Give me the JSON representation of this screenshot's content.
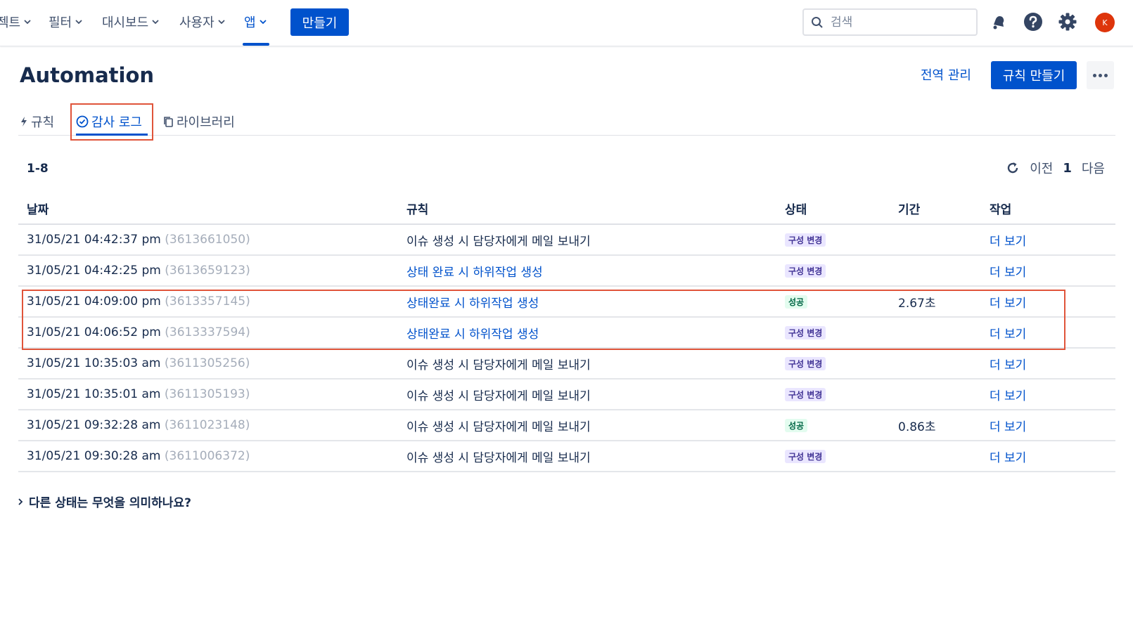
{
  "nav": {
    "items": [
      {
        "label": "젝트",
        "active": false
      },
      {
        "label": "필터",
        "active": false
      },
      {
        "label": "대시보드",
        "active": false
      },
      {
        "label": "사용자",
        "active": false
      },
      {
        "label": "앱",
        "active": true
      }
    ],
    "create_label": "만들기",
    "search_placeholder": "검색",
    "avatar_initial": "K"
  },
  "header": {
    "title": "Automation",
    "global_link": "전역 관리",
    "create_rule_label": "규칙 만들기"
  },
  "tabs": [
    {
      "label": "규칙",
      "icon": "lightning-icon",
      "active": false
    },
    {
      "label": "감사 로그",
      "icon": "check-circle-icon",
      "active": true
    },
    {
      "label": "라이브러리",
      "icon": "copy-icon",
      "active": false
    }
  ],
  "pagination": {
    "range": "1-8",
    "prev_label": "이전",
    "page": "1",
    "next_label": "다음"
  },
  "table": {
    "columns": [
      "날짜",
      "규칙",
      "상태",
      "기간",
      "작업"
    ],
    "rows": [
      {
        "date": "31/05/21 04:42:37 pm",
        "id": "(3613661050)",
        "rule": "이슈 생성 시 담당자에게 메일 보내기",
        "rule_link": false,
        "status": "구성 변경",
        "status_type": "config",
        "duration": "",
        "action": "더 보기"
      },
      {
        "date": "31/05/21 04:42:25 pm",
        "id": "(3613659123)",
        "rule": "상태 완료 시 하위작업 생성",
        "rule_link": true,
        "status": "구성 변경",
        "status_type": "config",
        "duration": "",
        "action": "더 보기"
      },
      {
        "date": "31/05/21 04:09:00 pm",
        "id": "(3613357145)",
        "rule": "상태완료 시 하위작업 생성",
        "rule_link": true,
        "status": "성공",
        "status_type": "success",
        "duration": "2.67초",
        "action": "더 보기"
      },
      {
        "date": "31/05/21 04:06:52 pm",
        "id": "(3613337594)",
        "rule": "상태완료 시 하위작업 생성",
        "rule_link": true,
        "status": "구성 변경",
        "status_type": "config",
        "duration": "",
        "action": "더 보기"
      },
      {
        "date": "31/05/21 10:35:03 am",
        "id": "(3611305256)",
        "rule": "이슈 생성 시 담당자에게 메일 보내기",
        "rule_link": false,
        "status": "구성 변경",
        "status_type": "config",
        "duration": "",
        "action": "더 보기"
      },
      {
        "date": "31/05/21 10:35:01 am",
        "id": "(3611305193)",
        "rule": "이슈 생성 시 담당자에게 메일 보내기",
        "rule_link": false,
        "status": "구성 변경",
        "status_type": "config",
        "duration": "",
        "action": "더 보기"
      },
      {
        "date": "31/05/21 09:32:28 am",
        "id": "(3611023148)",
        "rule": "이슈 생성 시 담당자에게 메일 보내기",
        "rule_link": false,
        "status": "성공",
        "status_type": "success",
        "duration": "0.86초",
        "action": "더 보기"
      },
      {
        "date": "31/05/21 09:30:28 am",
        "id": "(3611006372)",
        "rule": "이슈 생성 시 담당자에게 메일 보내기",
        "rule_link": false,
        "status": "구성 변경",
        "status_type": "config",
        "duration": "",
        "action": "더 보기"
      }
    ]
  },
  "faq": {
    "label": "다른 상태는 무엇을 의미하나요?"
  },
  "colors": {
    "primary": "#0052cc",
    "highlight": "#e0543a",
    "avatar": "#de350b"
  }
}
